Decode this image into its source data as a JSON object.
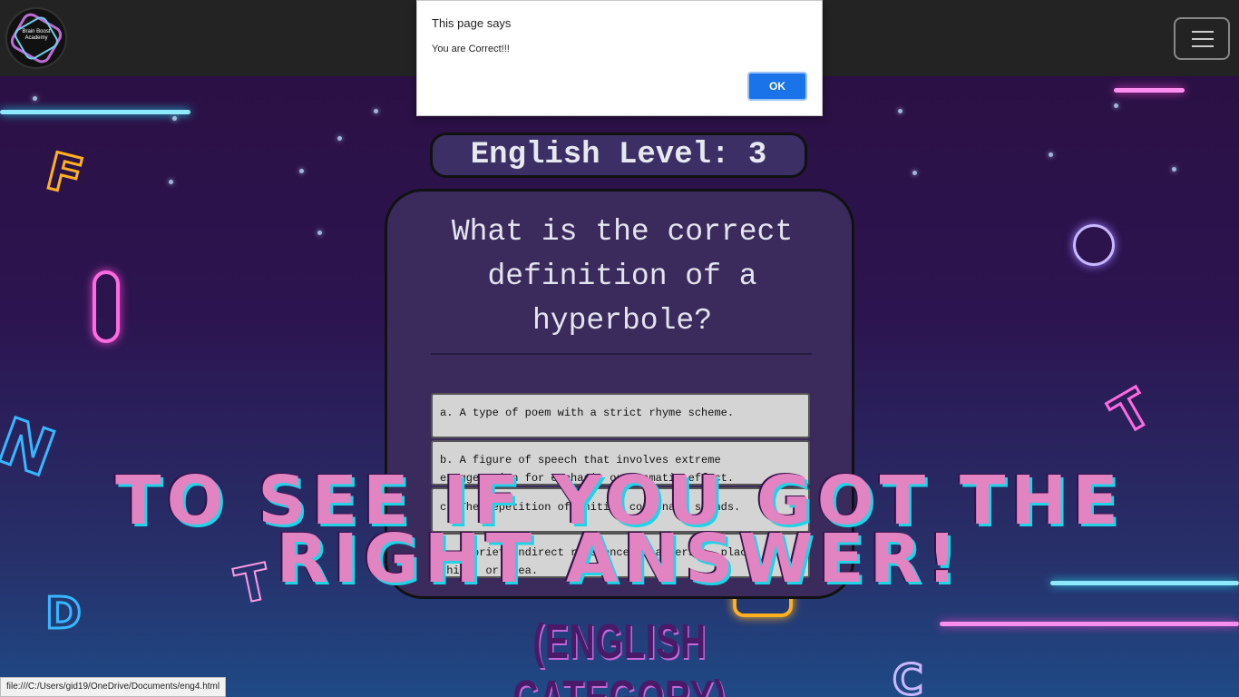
{
  "app": {
    "logo_text": "Brain Boost Academy",
    "menu_icon": "hamburger-icon"
  },
  "alert": {
    "title": "This page says",
    "message": "You are Correct!!!",
    "ok_label": "OK"
  },
  "quiz": {
    "level_title": "English Level: 3",
    "question": "What is the correct definition of a hyperbole?",
    "options": [
      {
        "text": "a. A type of poem with a strict rhyme scheme."
      },
      {
        "text": "b. A figure of speech that involves extreme exaggeration for emphasis or dramatic effect."
      },
      {
        "text": "c. The repetition of initial consonant sounds."
      },
      {
        "text": "d. A brief indirect reference to a person, place, thing, or idea."
      }
    ]
  },
  "overlay": {
    "headline": "TO SEE IF YOU GOT THE RIGHT ANSWER!",
    "subhead": "(ENGLISH CATEGORY)"
  },
  "status_url": "file:///C:/Users/gid19/OneDrive/Documents/eng4.html",
  "colors": {
    "navbar": "#232323",
    "card_bg": "#3b2a5c",
    "headline": "#e283c2",
    "headline_shadow": "#22d3e6",
    "ok_button": "#1a73e8"
  }
}
